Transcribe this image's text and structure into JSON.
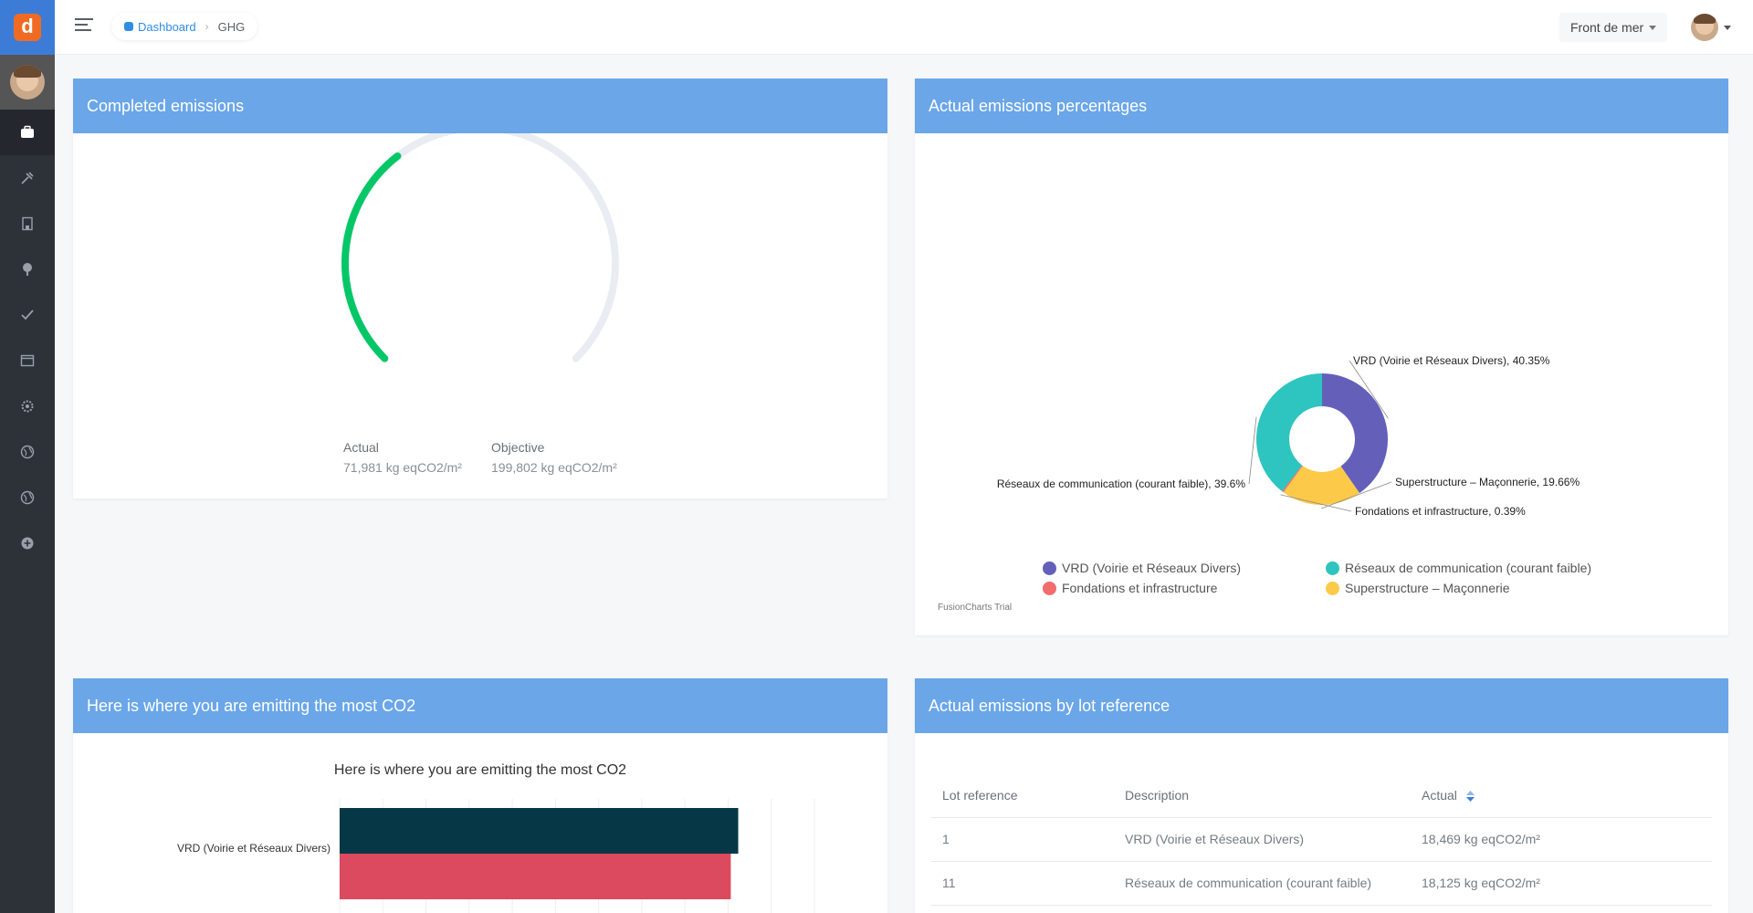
{
  "app": {
    "logo_letter": "d"
  },
  "breadcrumb": {
    "home": "Dashboard",
    "current": "GHG"
  },
  "project_select": {
    "value": "Front de mer"
  },
  "sidebar": {
    "items": [
      {
        "icon": "briefcase-icon",
        "active": true
      },
      {
        "icon": "tools-icon",
        "active": false
      },
      {
        "icon": "building-icon",
        "active": false
      },
      {
        "icon": "tree-icon",
        "active": false
      },
      {
        "icon": "check-icon",
        "active": false
      },
      {
        "icon": "window-icon",
        "active": false
      },
      {
        "icon": "gear-icon",
        "active": false
      },
      {
        "icon": "globe-icon",
        "active": false
      },
      {
        "icon": "globe-alt-icon",
        "active": false
      },
      {
        "icon": "plus-circle-icon",
        "active": false
      }
    ]
  },
  "completed": {
    "title": "Completed emissions",
    "actual_label": "Actual",
    "actual_value": "71,981 kg eqCO2/m²",
    "objective_label": "Objective",
    "objective_value": "199,802 kg eqCO2/m²",
    "actual_num": 71981,
    "objective_num": 199802,
    "colors": {
      "progress": "#06c768",
      "track": "#e9ecf2"
    }
  },
  "percentages": {
    "title": "Actual emissions percentages",
    "trial": "FusionCharts Trial"
  },
  "most": {
    "title": "Here is where you are emitting the most CO2"
  },
  "lot": {
    "title": "Actual emissions by lot reference",
    "headers": [
      "Lot reference",
      "Description",
      "Actual"
    ],
    "rows": [
      [
        "1",
        "VRD (Voirie et Réseaux Divers)",
        "18,469 kg eqCO2/m²"
      ],
      [
        "11",
        "Réseaux de communication (courant faible)",
        "18,125 kg eqCO2/m²"
      ]
    ]
  },
  "chart_data": [
    {
      "type": "pie",
      "variant": "doughnut",
      "slices": [
        {
          "label": "VRD (Voirie et Réseaux Divers)",
          "value": 40.35,
          "color": "#6460ba",
          "data_label": "VRD (Voirie et Réseaux Divers), 40.35%"
        },
        {
          "label": "Superstructure – Maçonnerie",
          "value": 19.66,
          "color": "#fcc949",
          "data_label": "Superstructure – Maçonnerie, 19.66%"
        },
        {
          "label": "Fondations et infrastructure",
          "value": 0.39,
          "color": "#f16c6c",
          "data_label": "Fondations et infrastructure, 0.39%"
        },
        {
          "label": "Réseaux de communication (courant faible)",
          "value": 39.6,
          "color": "#2ec4bf",
          "data_label": "Réseaux de communication (courant faible), 39.6%"
        }
      ],
      "legend": [
        "VRD (Voirie et Réseaux Divers)",
        "Réseaux de communication (courant faible)",
        "Fondations et infrastructure",
        "Superstructure – Maçonnerie"
      ],
      "legend_placement": "bottom"
    },
    {
      "type": "bar",
      "orientation": "horizontal",
      "title": "Here is where you are emitting the most CO2",
      "categories": [
        "VRD (Voirie et Réseaux Divers)"
      ],
      "series": [
        {
          "values": [
            18469
          ],
          "color": "#063746"
        },
        {
          "values": [
            18125
          ],
          "color": "#dc4a5f"
        }
      ],
      "xlim": [
        0,
        22000
      ],
      "grid": true
    }
  ]
}
